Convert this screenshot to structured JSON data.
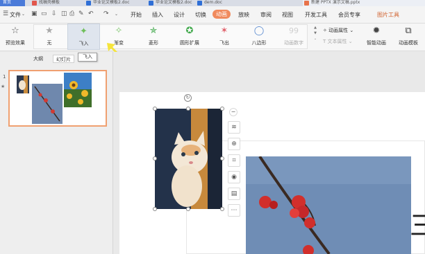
{
  "tabs": [
    {
      "label": "首页",
      "active": true
    },
    {
      "label": "找稿壳模板"
    },
    {
      "label": "毕业论文模板2.doc"
    },
    {
      "label": "毕业论文模板2.doc"
    },
    {
      "label": "dem.doc"
    },
    {
      "label": "新建 PPTX 演示文稿.pptx"
    }
  ],
  "menu": {
    "file": "文件",
    "items": [
      "开始",
      "插入",
      "设计",
      "切换",
      "动画",
      "放映",
      "审阅",
      "视图",
      "开发工具",
      "会员专享",
      "图片工具"
    ],
    "active": "动画"
  },
  "ribbon": {
    "preview": "预览效果",
    "effects": [
      {
        "label": "无",
        "icon": "none-star-icon"
      },
      {
        "label": "飞入",
        "icon": "fly-in-icon",
        "active": true
      },
      {
        "label": "渐变",
        "icon": "fade-icon"
      },
      {
        "label": "菱形",
        "icon": "diamond-icon"
      },
      {
        "label": "圆形扩展",
        "icon": "circle-expand-icon"
      },
      {
        "label": "飞出",
        "icon": "fly-out-icon"
      },
      {
        "label": "八边形",
        "icon": "octagon-icon"
      },
      {
        "label": "动画数字",
        "icon": "animated-number-icon",
        "disabled": true
      }
    ],
    "anim_props": "动画属性",
    "text_props": "文本属性",
    "smart_anim": "智能动画",
    "anim_template": "动画模板"
  },
  "panel": {
    "tabs": [
      "大纲",
      "幻灯片"
    ],
    "active_tab": "幻灯片",
    "tooltip": "飞入",
    "slide_number": "1",
    "star": "★"
  },
  "slide": {
    "side_text": "三"
  },
  "colors": {
    "accent": "#f08a5d",
    "active_button": "#dfe5ee",
    "thumb_border": "#f0a070",
    "arrow": "#f5e43c"
  }
}
